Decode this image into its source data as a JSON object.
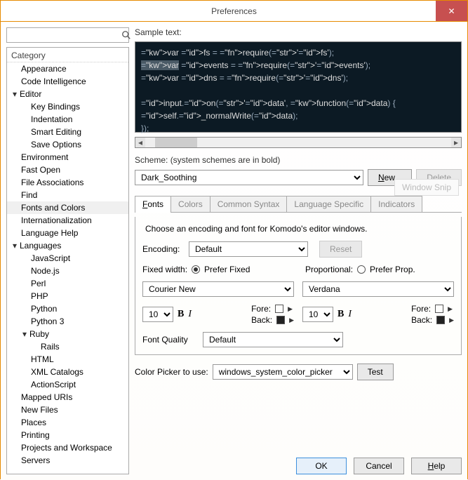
{
  "window": {
    "title": "Preferences"
  },
  "search": {
    "placeholder": ""
  },
  "tree_header": "Category",
  "tree": [
    {
      "label": "Appearance",
      "depth": 0
    },
    {
      "label": "Code Intelligence",
      "depth": 0
    },
    {
      "label": "Editor",
      "depth": 0,
      "expanded": true
    },
    {
      "label": "Key Bindings",
      "depth": 1
    },
    {
      "label": "Indentation",
      "depth": 1
    },
    {
      "label": "Smart Editing",
      "depth": 1
    },
    {
      "label": "Save Options",
      "depth": 1
    },
    {
      "label": "Environment",
      "depth": 0
    },
    {
      "label": "Fast Open",
      "depth": 0
    },
    {
      "label": "File Associations",
      "depth": 0
    },
    {
      "label": "Find",
      "depth": 0
    },
    {
      "label": "Fonts and Colors",
      "depth": 0,
      "selected": true
    },
    {
      "label": "Internationalization",
      "depth": 0
    },
    {
      "label": "Language Help",
      "depth": 0
    },
    {
      "label": "Languages",
      "depth": 0,
      "expanded": true
    },
    {
      "label": "JavaScript",
      "depth": 1
    },
    {
      "label": "Node.js",
      "depth": 1
    },
    {
      "label": "Perl",
      "depth": 1
    },
    {
      "label": "PHP",
      "depth": 1
    },
    {
      "label": "Python",
      "depth": 1
    },
    {
      "label": "Python 3",
      "depth": 1
    },
    {
      "label": "Ruby",
      "depth": 1,
      "expanded": true
    },
    {
      "label": "Rails",
      "depth": 2
    },
    {
      "label": "HTML",
      "depth": 1
    },
    {
      "label": "XML Catalogs",
      "depth": 1
    },
    {
      "label": "ActionScript",
      "depth": 1
    },
    {
      "label": "Mapped URIs",
      "depth": 0
    },
    {
      "label": "New Files",
      "depth": 0
    },
    {
      "label": "Places",
      "depth": 0
    },
    {
      "label": "Printing",
      "depth": 0
    },
    {
      "label": "Projects and Workspace",
      "depth": 0
    },
    {
      "label": "Servers",
      "depth": 0
    }
  ],
  "sample_label": "Sample text:",
  "sample_lines": [
    {
      "t": "var fs = require('fs');"
    },
    {
      "t": "var events = require('events');",
      "highlight": true
    },
    {
      "t": "var dns = require('dns');"
    },
    {
      "t": ""
    },
    {
      "t": "input.on('data', function(data) {"
    },
    {
      "t": "    self._normalWrite(data);"
    },
    {
      "t": "  });"
    }
  ],
  "scheme_label": "Scheme: (system schemes are in bold)",
  "scheme_value": "Dark_Soothing",
  "scheme_new": "New...",
  "scheme_delete": "Delete",
  "ghost_snip": "Window Snip",
  "tabs": [
    "Fonts",
    "Colors",
    "Common Syntax",
    "Language Specific",
    "Indicators"
  ],
  "active_tab": 0,
  "fonts_panel": {
    "instruction": "Choose an encoding and font for Komodo's editor windows.",
    "encoding_label": "Encoding:",
    "encoding_value": "Default",
    "reset_label": "Reset",
    "fixed_label": "Fixed width:",
    "fixed_radio": "Prefer Fixed",
    "prop_label": "Proportional:",
    "prop_radio": "Prefer Prop.",
    "fixed_font": "Courier New",
    "prop_font": "Verdana",
    "size_left": "10",
    "size_right": "10",
    "fore_label": "Fore:",
    "back_label": "Back:",
    "quality_label": "Font Quality",
    "quality_value": "Default"
  },
  "color_picker_label": "Color Picker to use:",
  "color_picker_value": "windows_system_color_picker",
  "test_label": "Test",
  "buttons": {
    "ok": "OK",
    "cancel": "Cancel",
    "help": "Help"
  }
}
